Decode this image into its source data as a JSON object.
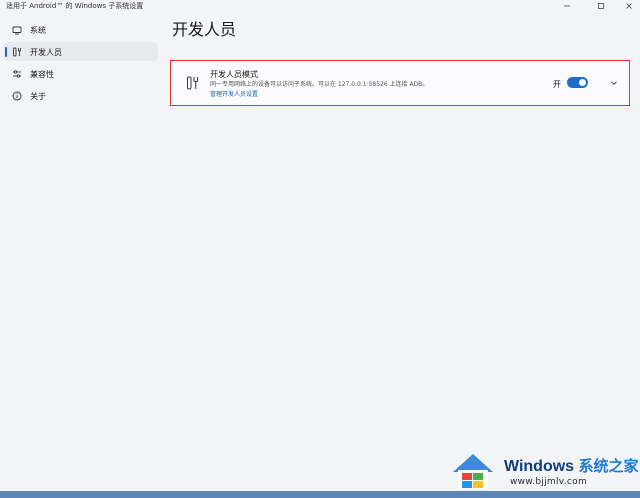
{
  "window": {
    "title": "适用于 Android™ 的 Windows 子系统设置",
    "controls": {
      "minimize_icon": "minimize-icon",
      "maximize_icon": "maximize-icon",
      "close_icon": "close-icon"
    }
  },
  "sidebar": {
    "items": [
      {
        "label": "系统",
        "icon": "monitor-icon",
        "selected": false
      },
      {
        "label": "开发人员",
        "icon": "developer-tools-icon",
        "selected": true
      },
      {
        "label": "兼容性",
        "icon": "sliders-icon",
        "selected": false
      },
      {
        "label": "关于",
        "icon": "info-icon",
        "selected": false
      }
    ]
  },
  "main": {
    "title": "开发人员",
    "developer_mode": {
      "icon": "developer-tools-icon",
      "title": "开发人员模式",
      "description": "同一专用网络上的设备可以访问子系统。可以在 127.0.0.1:58526 上连接 ADB。",
      "link": "管理开发人员设置",
      "toggle_label": "开",
      "toggle_on": true
    }
  },
  "watermark": {
    "brand": "Windows",
    "brand_cn": "系统之家",
    "url": "www.bjjmlv.com"
  },
  "colors": {
    "accent": "#1b6fc8",
    "highlight_border": "#e3342f",
    "background": "#f3f4f8"
  }
}
